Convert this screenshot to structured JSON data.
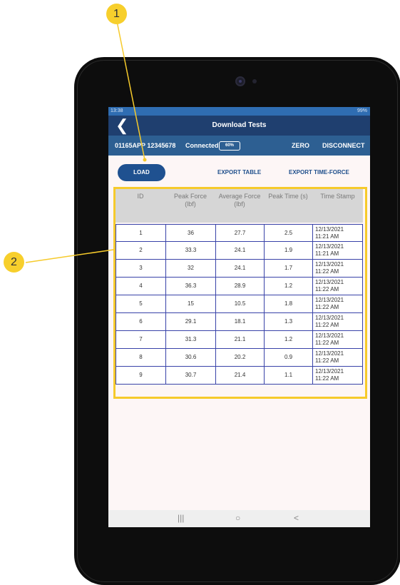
{
  "callouts": {
    "one": "1",
    "two": "2"
  },
  "statusbar": {
    "time": "13:38",
    "battery": "99%"
  },
  "header": {
    "back_icon": "chevron-left-icon",
    "title": "Download Tests"
  },
  "device": {
    "name": "01165APP 12345678",
    "status": "Connected",
    "battery": "60%",
    "zero_label": "ZERO",
    "disconnect_label": "DISCONNECT"
  },
  "actions": {
    "load_label": "LOAD",
    "export_table_label": "EXPORT TABLE",
    "export_tf_label": "EXPORT TIME-FORCE"
  },
  "table": {
    "columns": [
      "ID",
      "Peak Force\n(lbf)",
      "Average Force\n(lbf)",
      "Peak Time (s)",
      "Time Stamp"
    ],
    "rows": [
      [
        "1",
        "36",
        "27.7",
        "2.5",
        "12/13/2021\n11:21 AM"
      ],
      [
        "2",
        "33.3",
        "24.1",
        "1.9",
        "12/13/2021\n11:21 AM"
      ],
      [
        "3",
        "32",
        "24.1",
        "1.7",
        "12/13/2021\n11:22 AM"
      ],
      [
        "4",
        "36.3",
        "28.9",
        "1.2",
        "12/13/2021\n11:22 AM"
      ],
      [
        "5",
        "15",
        "10.5",
        "1.8",
        "12/13/2021\n11:22 AM"
      ],
      [
        "6",
        "29.1",
        "18.1",
        "1.3",
        "12/13/2021\n11:22 AM"
      ],
      [
        "7",
        "31.3",
        "21.1",
        "1.2",
        "12/13/2021\n11:22 AM"
      ],
      [
        "8",
        "30.6",
        "20.2",
        "0.9",
        "12/13/2021\n11:22 AM"
      ],
      [
        "9",
        "30.7",
        "21.4",
        "1.1",
        "12/13/2021\n11:22 AM"
      ]
    ]
  },
  "navbar": {
    "recent": "|||",
    "home": "○",
    "back": "<"
  },
  "colors": {
    "callout": "#f7cf2c",
    "header": "#1f3f6f",
    "devbar": "#2d5f92",
    "accent": "#1f5190",
    "grid": "#3842a8"
  }
}
